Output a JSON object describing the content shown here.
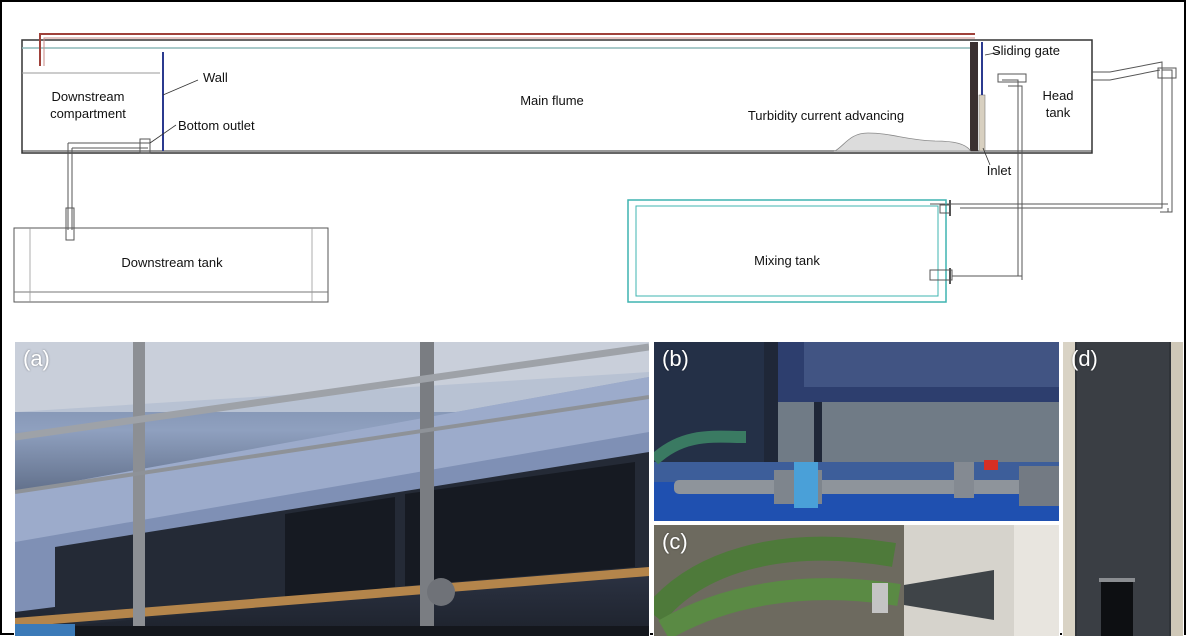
{
  "diagram": {
    "labels": {
      "downstream_compartment_line1": "Downstream",
      "downstream_compartment_line2": "compartment",
      "wall": "Wall",
      "bottom_outlet": "Bottom outlet",
      "main_flume": "Main flume",
      "turbidity_current": "Turbidity current advancing",
      "sliding_gate": "Sliding gate",
      "head_tank_line1": "Head",
      "head_tank_line2": "tank",
      "inlet": "Inlet",
      "downstream_tank": "Downstream tank",
      "mixing_tank": "Mixing tank"
    },
    "colors": {
      "outline": "#333333",
      "flume_top_pipe": "#a0413a",
      "flume_top_teal": "#8bb7b7",
      "wall": "#2b3a8f",
      "mixing_tank": "#3fb4b0",
      "gate": "#3a3030",
      "sediment": "#dcdcdc"
    }
  },
  "photos": [
    {
      "id": "a",
      "label": "(a)"
    },
    {
      "id": "b",
      "label": "(b)"
    },
    {
      "id": "c",
      "label": "(c)"
    },
    {
      "id": "d",
      "label": "(d)"
    }
  ]
}
